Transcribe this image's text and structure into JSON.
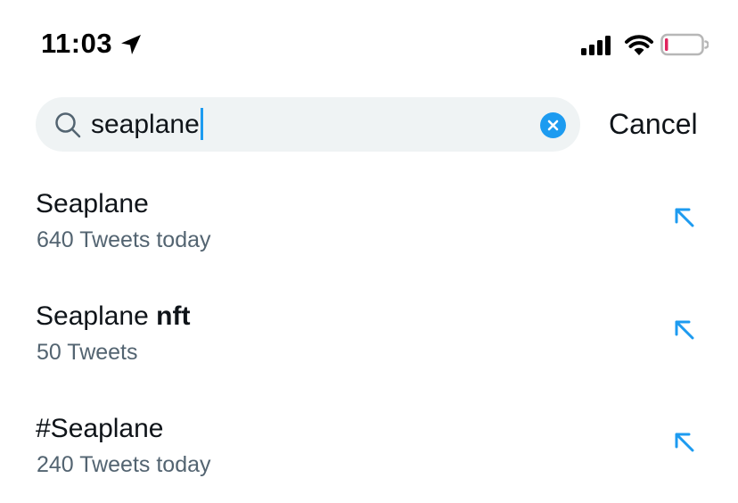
{
  "status_bar": {
    "time": "11:03",
    "icons": [
      "location-arrow-icon",
      "cellular-signal-icon",
      "wifi-icon",
      "battery-low-icon"
    ]
  },
  "search": {
    "query": "seaplane",
    "clear_icon": "clear-circle-icon",
    "cancel_label": "Cancel"
  },
  "suggestions": [
    {
      "title_plain": "Seaplane",
      "title_bold": "",
      "subtitle": "640 Tweets today",
      "icon": "arrow-up-left-icon"
    },
    {
      "title_plain": "Seaplane ",
      "title_bold": "nft",
      "subtitle": "50 Tweets",
      "icon": "arrow-up-left-icon"
    },
    {
      "title_plain": "#Seaplane",
      "title_bold": "",
      "subtitle": "240 Tweets today",
      "icon": "arrow-up-left-icon"
    }
  ],
  "colors": {
    "accent": "#1d9bf0",
    "secondary_text": "#536471",
    "search_bg": "#eff3f4",
    "battery_low": "#e0245e"
  }
}
